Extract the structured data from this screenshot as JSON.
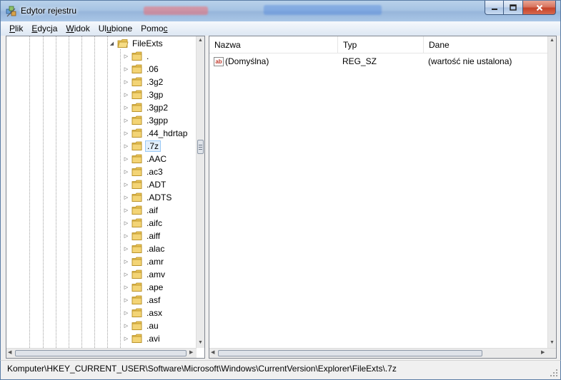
{
  "window": {
    "title": "Edytor rejestru"
  },
  "menu": {
    "items": [
      {
        "label": "Plik",
        "accel_index": 0
      },
      {
        "label": "Edycja",
        "accel_index": 0
      },
      {
        "label": "Widok",
        "accel_index": 0
      },
      {
        "label": "Ulubione",
        "accel_index": 2
      },
      {
        "label": "Pomoc",
        "accel_index": 4
      }
    ]
  },
  "tree": {
    "parent": {
      "label": "FileExts",
      "expanded": true
    },
    "selected_index": 7,
    "children": [
      ".",
      ".06",
      ".3g2",
      ".3gp",
      ".3gp2",
      ".3gpp",
      ".44_hdrtap",
      ".7z",
      ".AAC",
      ".ac3",
      ".ADT",
      ".ADTS",
      ".aif",
      ".aifc",
      ".aiff",
      ".alac",
      ".amr",
      ".amv",
      ".ape",
      ".asf",
      ".asx",
      ".au",
      ".avi"
    ]
  },
  "list": {
    "columns": {
      "name": "Nazwa",
      "type": "Typ",
      "data": "Dane"
    },
    "rows": [
      {
        "icon": "string-value-icon",
        "name": "(Domyślna)",
        "type": "REG_SZ",
        "data": "(wartość nie ustalona)"
      }
    ]
  },
  "status": {
    "path": "Komputer\\HKEY_CURRENT_USER\\Software\\Microsoft\\Windows\\CurrentVersion\\Explorer\\FileExts\\.7z"
  },
  "colors": {
    "selection_bg": "#e3effb",
    "selection_border": "#99c8f6",
    "folder": "#e8c256"
  }
}
